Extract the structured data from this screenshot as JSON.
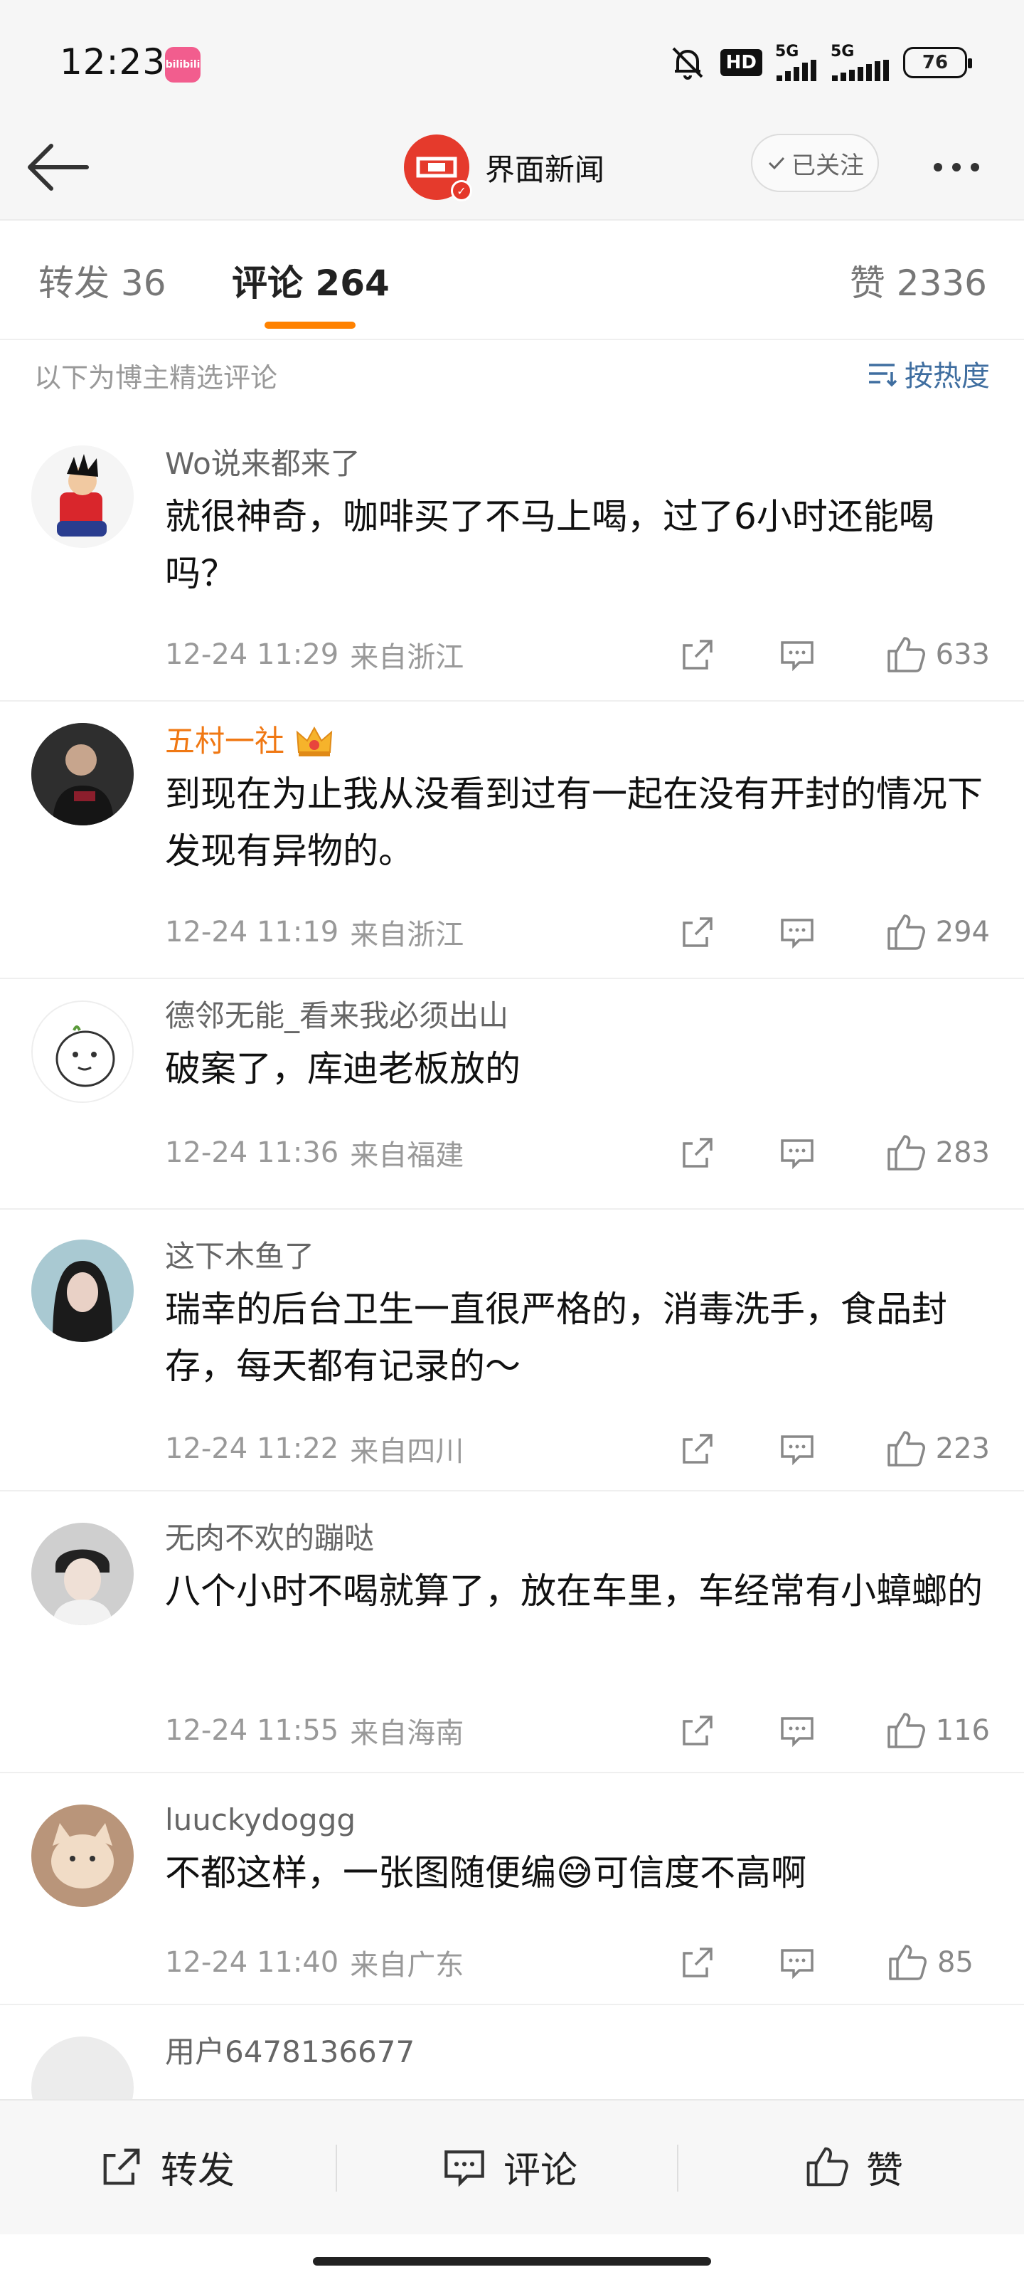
{
  "status_bar": {
    "time": "12:23",
    "app_badge": "bilibili",
    "hd": "HD",
    "network1": "5G",
    "network2": "5G",
    "battery": "76"
  },
  "header": {
    "account_name": "界面新闻",
    "follow_label": "已关注"
  },
  "tabs": {
    "repost": "转发 36",
    "comment": "评论 264",
    "like": "赞 2336"
  },
  "filter": {
    "note": "以下为博主精选评论",
    "sort_label": "按热度"
  },
  "comments": [
    {
      "user": "Wo说来都来了",
      "text": "就很神奇，咖啡买了不马上喝，过了6小时还能喝吗？",
      "date": "12-24 11:29",
      "location": "来自浙江",
      "likes": "633"
    },
    {
      "user": "五村一社",
      "text": "到现在为止我从没看到过有一起在没有开封的情况下发现有异物的。",
      "date": "12-24 11:19",
      "location": "来自浙江",
      "likes": "294"
    },
    {
      "user": "德邻无能_看来我必须出山",
      "text": "破案了，库迪老板放的",
      "date": "12-24 11:36",
      "location": "来自福建",
      "likes": "283"
    },
    {
      "user": "这下木鱼了",
      "text": "瑞幸的后台卫生一直很严格的，消毒洗手，食品封存，每天都有记录的～",
      "date": "12-24 11:22",
      "location": "来自四川",
      "likes": "223"
    },
    {
      "user": "无肉不欢的蹦哒",
      "text": "八个小时不喝就算了，放在车里，车经常有小蟑螂的",
      "date": "12-24 11:55",
      "location": "来自海南",
      "likes": "116"
    },
    {
      "user": "luuckydoggg",
      "text": "不都这样，一张图随便编😅可信度不高啊",
      "date": "12-24 11:40",
      "location": "来自广东",
      "likes": "85"
    },
    {
      "user": "用户6478136677"
    }
  ],
  "bottom_bar": {
    "repost": "转发",
    "comment": "评论",
    "like": "赞"
  },
  "colors": {
    "accent_orange": "#ff8200",
    "link_blue": "#3f6ea0",
    "vip_orange": "#f07813",
    "brand_red": "#e53a2c"
  }
}
